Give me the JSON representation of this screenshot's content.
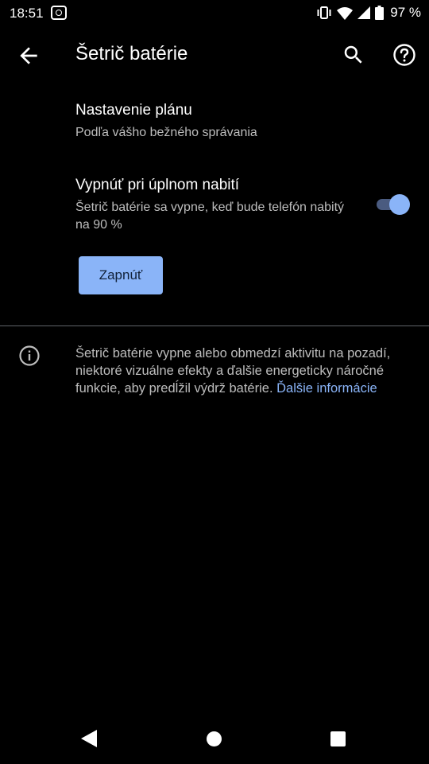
{
  "status_bar": {
    "time": "18:51",
    "battery_text": "97 %",
    "icons": [
      "notification-app-icon",
      "vibrate-icon",
      "wifi-icon",
      "signal-icon",
      "battery-icon"
    ]
  },
  "app_bar": {
    "title": "Šetrič batérie",
    "back_icon": "arrow-back-icon",
    "search_icon": "search-icon",
    "help_icon": "help-circle-icon"
  },
  "settings": {
    "schedule": {
      "title": "Nastavenie plánu",
      "summary": "Podľa vášho bežného správania"
    },
    "turn_off_when_charged": {
      "title": "Vypnúť pri úplnom nabití",
      "summary": "Šetrič batérie sa vypne, keď bude telefón nabitý na 90 %",
      "toggle_on": true
    },
    "turn_on_button": "Zapnúť"
  },
  "info": {
    "icon": "info-icon",
    "text": "Šetrič batérie vypne alebo obmedzí aktivitu na pozadí, niektoré vizuálne efekty a ďalšie energeticky náročné funkcie, aby predĺžil výdrž batérie.",
    "link_text": "Ďalšie informácie"
  },
  "nav_bar": {
    "icons": [
      "nav-back-icon",
      "nav-home-icon",
      "nav-recents-icon"
    ]
  },
  "colors": {
    "background": "#000000",
    "accent": "#8ab4f8",
    "secondary_text": "#bdbdbd",
    "divider": "#5f6368"
  }
}
